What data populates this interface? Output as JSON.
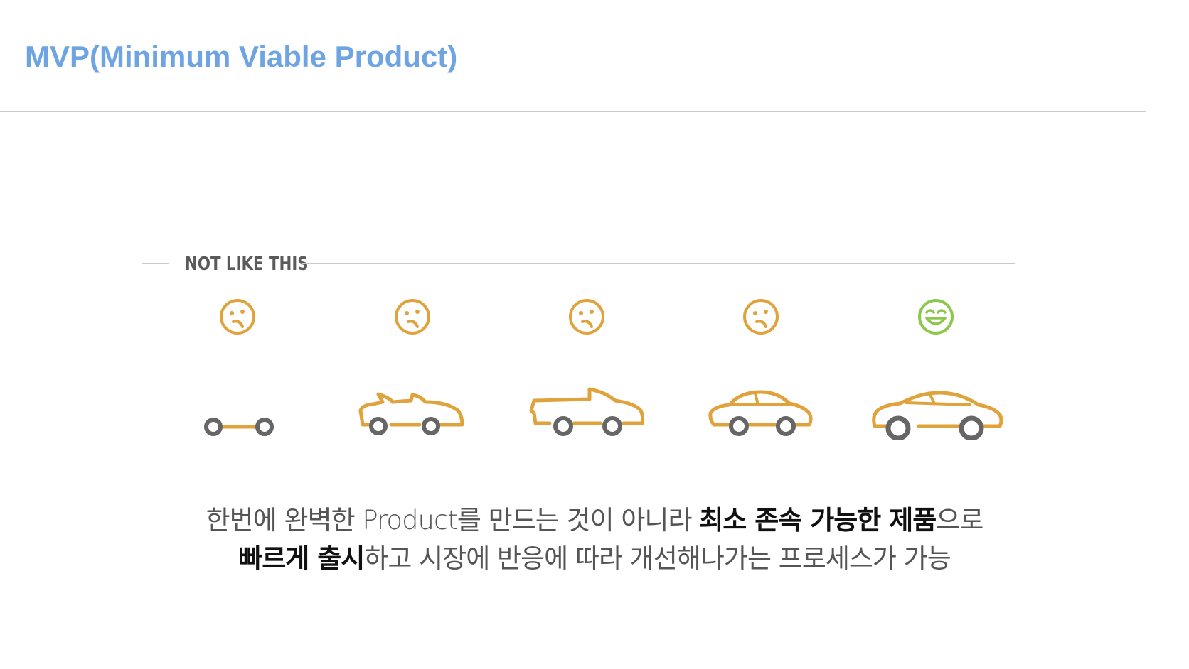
{
  "slide": {
    "title": "MVP(Minimum Viable Product)"
  },
  "section": {
    "label": "NOT LIKE THIS"
  },
  "stages": [
    {
      "face": "sad-face-icon",
      "vehicle": "skateboard-axle-icon",
      "face_color": "#e0a33b"
    },
    {
      "face": "sad-face-icon",
      "vehicle": "convertible-frame-icon",
      "face_color": "#e0a33b"
    },
    {
      "face": "sad-face-icon",
      "vehicle": "pickup-convertible-icon",
      "face_color": "#e0a33b"
    },
    {
      "face": "sad-face-icon",
      "vehicle": "compact-car-icon",
      "face_color": "#e0a33b"
    },
    {
      "face": "happy-face-icon",
      "vehicle": "sedan-car-icon",
      "face_color": "#8cc84b"
    }
  ],
  "colors": {
    "title": "#6fa4e3",
    "vehicle_body": "#e0a33b",
    "wheel": "#666666",
    "sad_face": "#e0a33b",
    "happy_face": "#8cc84b"
  },
  "caption": {
    "line1_a": "한번에 완벽한 Product를 만드는 것이 아니라 ",
    "line1_b": "최소 존속 가능한 제품",
    "line1_c": "으로",
    "line2_a": "빠르게 출시",
    "line2_b": "하고 시장에 반응에 따라 개선해나가는 프로세스가 가능"
  }
}
